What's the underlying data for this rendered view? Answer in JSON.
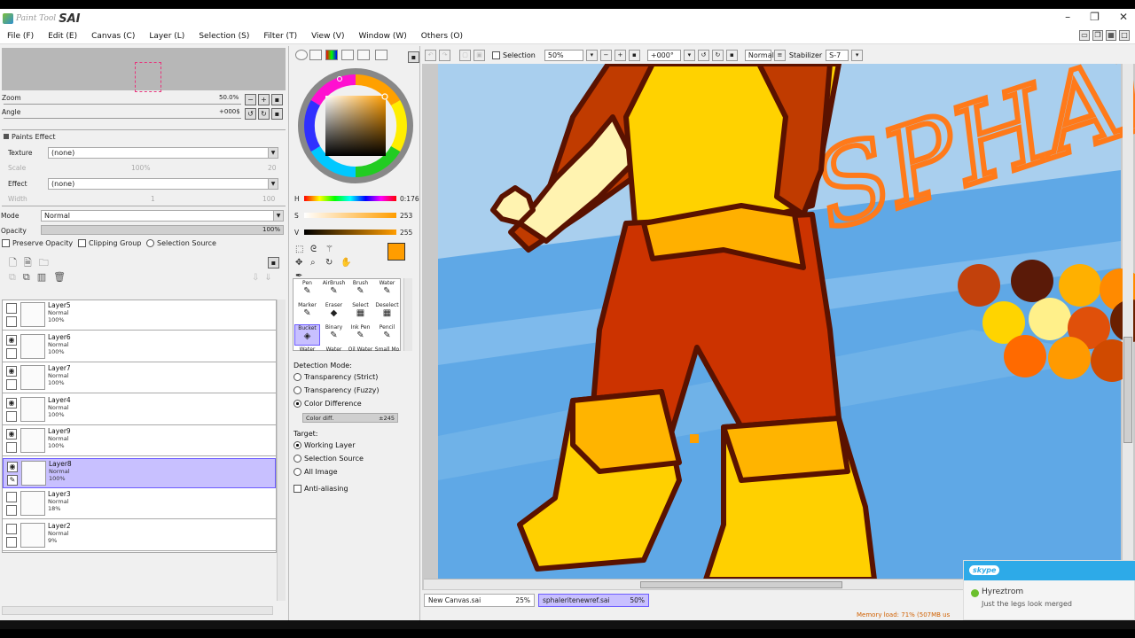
{
  "app": {
    "brand_small": "Paint Tool",
    "brand_big": "SAI"
  },
  "menu": [
    "File (F)",
    "Edit (E)",
    "Canvas (C)",
    "Layer (L)",
    "Selection (S)",
    "Filter (T)",
    "View (V)",
    "Window (W)",
    "Others (O)"
  ],
  "nav": {
    "zoom_label": "Zoom",
    "zoom_value": "50.0%",
    "angle_label": "Angle",
    "angle_value": "+000$"
  },
  "paints_effect": {
    "header": "Paints Effect",
    "texture_label": "Texture",
    "texture_value": "(none)",
    "scale_label": "Scale",
    "scale_value": "100%",
    "scale_num": "20",
    "effect_label": "Effect",
    "effect_value": "(none)",
    "width_label": "Width",
    "width_num": "1",
    "width_num2": "100"
  },
  "blend": {
    "mode_label": "Mode",
    "mode_value": "Normal",
    "opacity_label": "Opacity",
    "opacity_value": "100%"
  },
  "layer_opts": {
    "preserve": "Preserve Opacity",
    "clipping": "Clipping Group",
    "selsrc": "Selection Source"
  },
  "layers": [
    {
      "name": "Layer5",
      "mode": "Normal",
      "opacity": "100%",
      "visible": false,
      "selected": false
    },
    {
      "name": "Layer6",
      "mode": "Normal",
      "opacity": "100%",
      "visible": true,
      "selected": false
    },
    {
      "name": "Layer7",
      "mode": "Normal",
      "opacity": "100%",
      "visible": true,
      "selected": false
    },
    {
      "name": "Layer4",
      "mode": "Normal",
      "opacity": "100%",
      "visible": true,
      "selected": false
    },
    {
      "name": "Layer9",
      "mode": "Normal",
      "opacity": "100%",
      "visible": true,
      "selected": false
    },
    {
      "name": "Layer8",
      "mode": "Normal",
      "opacity": "100%",
      "visible": true,
      "selected": true
    },
    {
      "name": "Layer3",
      "mode": "Normal",
      "opacity": "18%",
      "visible": false,
      "selected": false
    },
    {
      "name": "Layer2",
      "mode": "Normal",
      "opacity": "9%",
      "visible": false,
      "selected": false
    }
  ],
  "color": {
    "h_label": "H",
    "h_value": "0:176",
    "s_label": "S",
    "s_value": "253",
    "v_label": "V",
    "v_value": "255",
    "current": "#ff9d00"
  },
  "tools": [
    {
      "label": "Pen",
      "icon": "✎"
    },
    {
      "label": "AirBrush",
      "icon": "✎"
    },
    {
      "label": "Brush",
      "icon": "✎"
    },
    {
      "label": "Water",
      "icon": "✎"
    },
    {
      "label": "Marker",
      "icon": "✎"
    },
    {
      "label": "Eraser",
      "icon": "◆"
    },
    {
      "label": "Select",
      "icon": "▦"
    },
    {
      "label": "Deselect",
      "icon": "▦"
    },
    {
      "label": "Bucket",
      "icon": "◈"
    },
    {
      "label": "Binary",
      "icon": "✎"
    },
    {
      "label": "Ink Pen",
      "icon": "✎"
    },
    {
      "label": "Pencil",
      "icon": "✎"
    },
    {
      "label": "Water",
      "icon": ""
    },
    {
      "label": "Water",
      "icon": ""
    },
    {
      "label": "Oil Water",
      "icon": ""
    },
    {
      "label": "Small Mo",
      "icon": ""
    }
  ],
  "bucket": {
    "detection_label": "Detection Mode:",
    "opt_strict": "Transparency (Strict)",
    "opt_fuzzy": "Transparency (Fuzzy)",
    "opt_color": "Color Difference",
    "color_diff_label": "Color diff.",
    "color_diff_value": "±245",
    "target_label": "Target:",
    "t_working": "Working Layer",
    "t_selsrc": "Selection Source",
    "t_all": "All Image",
    "antialias": "Anti-aliasing"
  },
  "toolbar": {
    "selection_label": "Selection",
    "zoom": "50%",
    "angle": "+000°",
    "mode": "Normal",
    "stabilizer_label": "Stabilizer",
    "stabilizer_value": "S-7"
  },
  "canvas_text": "SPHALER",
  "doctabs": [
    {
      "name": "New Canvas.sai",
      "zoom": "25%",
      "active": false
    },
    {
      "name": "sphaleritenewref.sai",
      "zoom": "50%",
      "active": true
    }
  ],
  "status": "Memory load: 71% (507MB us",
  "skype": {
    "logo": "skype",
    "name": "Hyreztrom",
    "message": "Just the legs look merged"
  },
  "colors": {
    "accent": "#c8c0ff",
    "accent_border": "#6c5cff",
    "skype": "#2daae8"
  }
}
